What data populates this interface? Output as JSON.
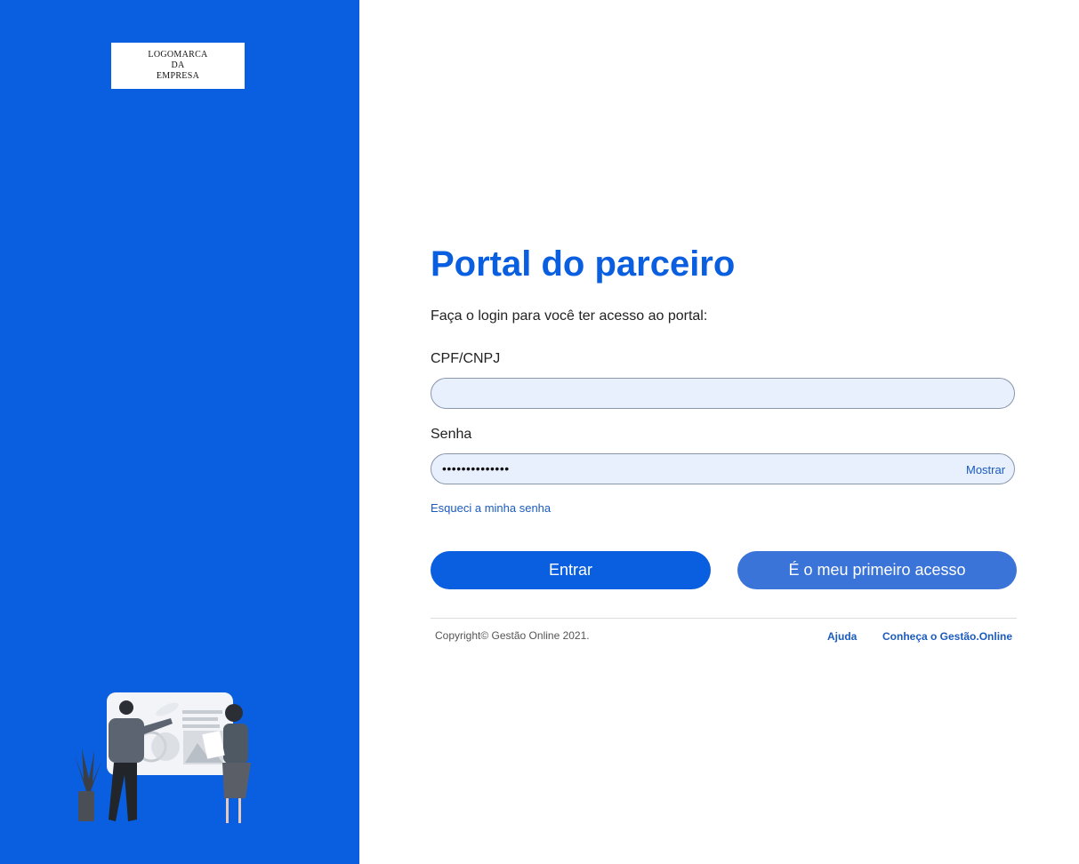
{
  "brand": {
    "logo_text": [
      "LOGOMARCA",
      "DA",
      "EMPRESA"
    ],
    "primary_color": "#0a5ee0",
    "link_color": "#1a5bbf"
  },
  "login": {
    "title": "Portal do parceiro",
    "subtitle": "Faça o login para você ter acesso ao portal:",
    "cpf_label": "CPF/CNPJ",
    "cpf_value": "",
    "password_label": "Senha",
    "password_value": "••••••••••••••",
    "show_password": "Mostrar",
    "forgot_password": "Esqueci a minha senha",
    "submit_button": "Entrar",
    "first_access_button": "É o meu primeiro acesso"
  },
  "footer": {
    "copyright": "Copyright© Gestão Online 2021.",
    "help_link": "Ajuda",
    "about_link": "Conheça o Gestão.Online"
  }
}
